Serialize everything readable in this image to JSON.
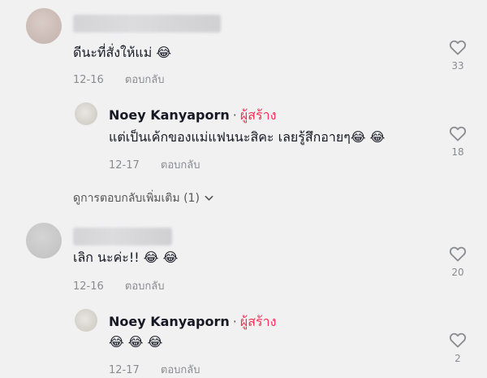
{
  "comments": [
    {
      "text": "ดีนะที่สั่งให้แม่ 😂",
      "date": "12-16",
      "reply_label": "ตอบกลับ",
      "likes": "33",
      "replies": [
        {
          "author": "Noey Kanyaporn",
          "dot": "·",
          "creator_badge": "ผู้สร้าง",
          "text": "แต่เป็นเค้กของแม่แฟนนะสิคะ เลยรู้สึกอายๆ😂 😂",
          "date": "12-17",
          "reply_label": "ตอบกลับ",
          "likes": "18"
        }
      ],
      "view_more": "ดูการตอบกลับเพิ่มเติม (1)"
    },
    {
      "text": "เลิก นะค่ะ!! 😂 😂",
      "date": "12-16",
      "reply_label": "ตอบกลับ",
      "likes": "20",
      "replies": [
        {
          "author": "Noey Kanyaporn",
          "dot": "·",
          "creator_badge": "ผู้สร้าง",
          "text": "😂 😂 😂",
          "date": "12-17",
          "reply_label": "ตอบกลับ",
          "likes": "2"
        }
      ]
    }
  ],
  "icons": {
    "like": "heart-outline-icon",
    "expand": "chevron-down-icon"
  },
  "colors": {
    "creator": "#fe2c55",
    "meta": "#8a8b91",
    "background": "#f1f1f2"
  }
}
